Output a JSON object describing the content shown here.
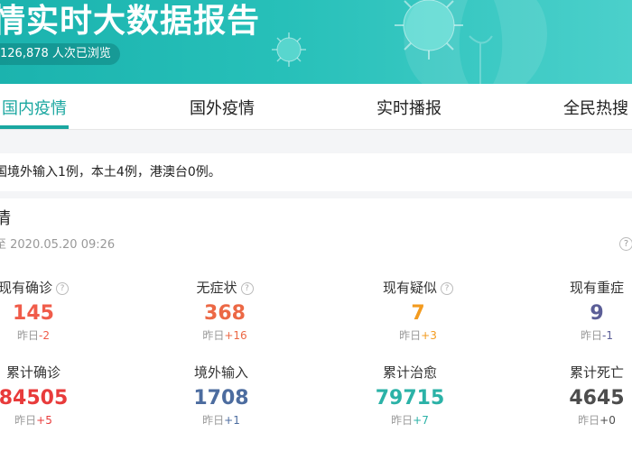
{
  "header": {
    "title": "情实时大数据报告",
    "views": "126,878 人次已浏览"
  },
  "tabs": [
    {
      "label": "国内疫情"
    },
    {
      "label": "国外疫情"
    },
    {
      "label": "实时播报"
    },
    {
      "label": "全民热搜"
    }
  ],
  "notice": "国境外输入1例，本土4例，港澳台0例。",
  "card": {
    "title": "情",
    "time": "至 2020.05.20 09:26",
    "help": "?"
  },
  "stats": [
    {
      "label": "现有确诊",
      "value": "145",
      "delta_label": "昨日",
      "delta": "-2",
      "color": "#f05c4a",
      "delta_color": "#f05c4a"
    },
    {
      "label": "无症状",
      "value": "368",
      "delta_label": "昨日",
      "delta": "+16",
      "color": "#ec6845",
      "delta_color": "#ec6845"
    },
    {
      "label": "现有疑似",
      "value": "7",
      "delta_label": "昨日",
      "delta": "+3",
      "color": "#f39b1f",
      "delta_color": "#f39b1f"
    },
    {
      "label": "现有重症",
      "value": "9",
      "delta_label": "昨日",
      "delta": "-1",
      "color": "#5b5e97",
      "delta_color": "#5b5e97"
    },
    {
      "label": "累计确诊",
      "value": "84505",
      "delta_label": "昨日",
      "delta": "+5",
      "color": "#e83b3b",
      "delta_color": "#e83b3b"
    },
    {
      "label": "境外输入",
      "value": "1708",
      "delta_label": "昨日",
      "delta": "+1",
      "color": "#4c6c9f",
      "delta_color": "#4c6c9f"
    },
    {
      "label": "累计治愈",
      "value": "79715",
      "delta_label": "昨日",
      "delta": "+7",
      "color": "#2bb2a7",
      "delta_color": "#2bb2a7"
    },
    {
      "label": "累计死亡",
      "value": "4645",
      "delta_label": "昨日",
      "delta": "+0",
      "color": "#4d4d4d",
      "delta_color": "#4d4d4d"
    }
  ],
  "colors": {
    "accent": "#1aa7a0",
    "banner": "#27c0b9"
  }
}
